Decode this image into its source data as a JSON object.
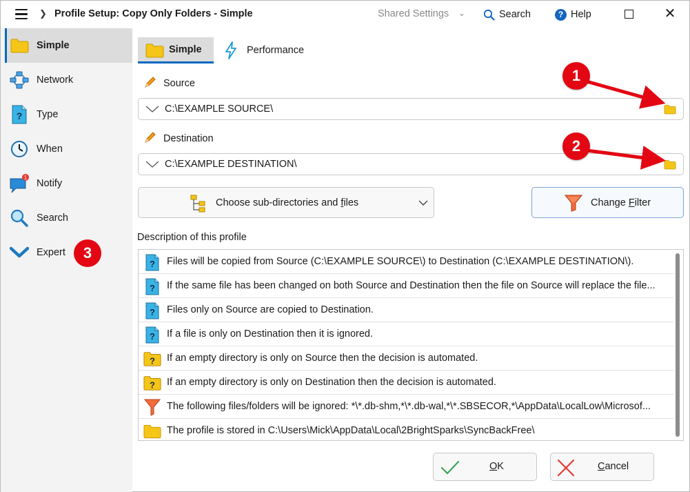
{
  "window": {
    "title": "Profile Setup: Copy Only Folders - Simple",
    "shared_settings": "Shared Settings",
    "search_label": "Search",
    "help_label": "Help"
  },
  "sidebar": {
    "items": [
      {
        "label": "Simple",
        "icon": "folder-icon",
        "active": true
      },
      {
        "label": "Network",
        "icon": "network-icon"
      },
      {
        "label": "Type",
        "icon": "type-icon"
      },
      {
        "label": "When",
        "icon": "clock-icon"
      },
      {
        "label": "Notify",
        "icon": "chat-icon"
      },
      {
        "label": "Search",
        "icon": "search-icon"
      },
      {
        "label": "Expert",
        "icon": "chevron-down-icon"
      }
    ],
    "notify_badge": "1"
  },
  "tabs": [
    {
      "label": "Simple",
      "icon": "folder-icon",
      "active": true
    },
    {
      "label": "Performance",
      "icon": "lightning-icon"
    }
  ],
  "source": {
    "label": "Source",
    "value": "C:\\EXAMPLE SOURCE\\"
  },
  "destination": {
    "label": "Destination",
    "value": "C:\\EXAMPLE DESTINATION\\"
  },
  "buttons": {
    "choose_prefix": "Choose sub-directories and ",
    "choose_underlined": "f",
    "choose_suffix": "iles",
    "filter_prefix": "Change ",
    "filter_underlined": "F",
    "filter_suffix": "ilter",
    "ok_underlined": "O",
    "ok_suffix": "K",
    "cancel_underlined": "C",
    "cancel_suffix": "ancel"
  },
  "description": {
    "title": "Description of this profile",
    "rows": [
      {
        "icon": "info-doc-icon",
        "text": "Files will be copied from Source (C:\\EXAMPLE SOURCE\\) to Destination (C:\\EXAMPLE DESTINATION\\)."
      },
      {
        "icon": "info-doc-icon",
        "text": "If the same file has been changed on both Source and Destination then the file on Source will replace the file..."
      },
      {
        "icon": "info-doc-icon",
        "text": "Files only on Source are copied to Destination."
      },
      {
        "icon": "info-doc-icon",
        "text": "If a file is only on Destination then it is ignored."
      },
      {
        "icon": "folder-question-icon",
        "text": "If an empty directory is only on Source then the decision is automated."
      },
      {
        "icon": "folder-question-icon",
        "text": "If an empty directory is only on Destination then the decision is automated."
      },
      {
        "icon": "filter-icon",
        "text": "The following files/folders will be ignored: *\\*.db-shm,*\\*.db-wal,*\\*.SBSECOR,*\\AppData\\LocalLow\\Microsof..."
      },
      {
        "icon": "folder-icon",
        "text": "The profile is stored in C:\\Users\\Mick\\AppData\\Local\\2BrightSparks\\SyncBackFree\\"
      }
    ]
  },
  "annotations": {
    "marker1": "1",
    "marker2": "2",
    "marker3": "3",
    "color": "#e30613"
  },
  "colors": {
    "accent": "#0067c0",
    "folder": "#f5c518",
    "sidebar_bg": "#f3f3f3",
    "annotation_red": "#e30613"
  }
}
